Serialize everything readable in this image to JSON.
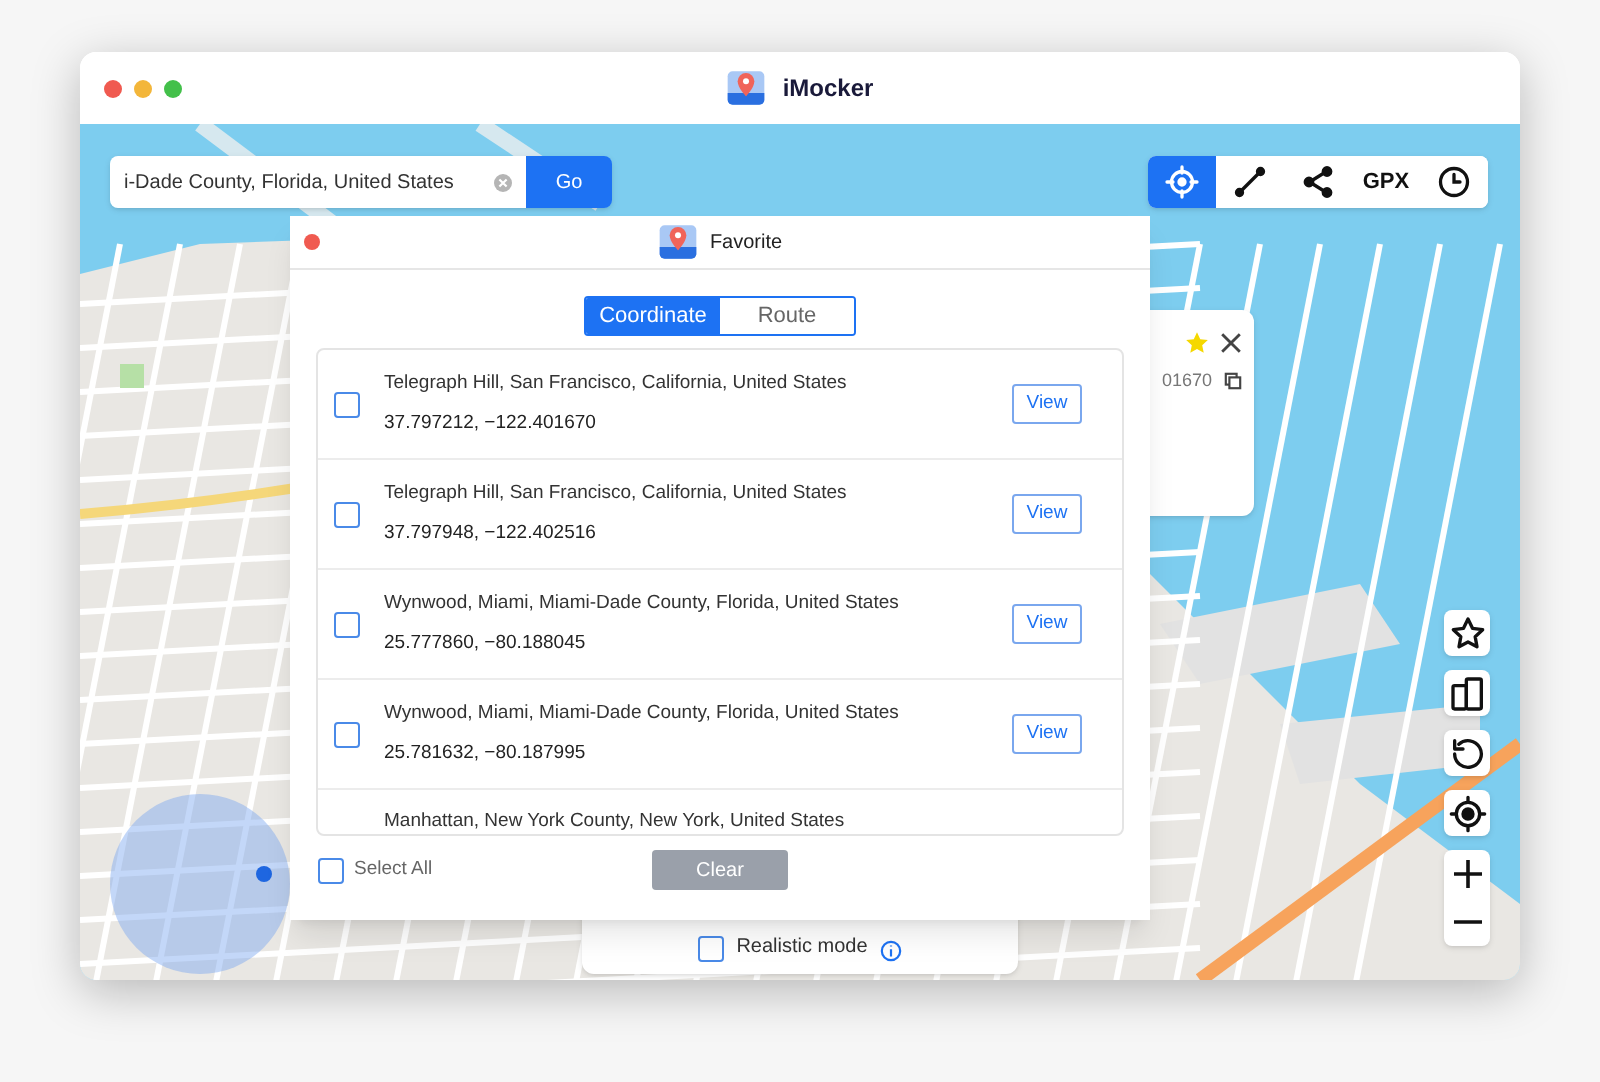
{
  "window": {
    "title": "iMocker"
  },
  "search": {
    "value": "i-Dade County, Florida, United States",
    "go": "Go"
  },
  "toolbar": [
    {
      "kind": "crosshair",
      "selected": true
    },
    {
      "kind": "route",
      "selected": false
    },
    {
      "kind": "share",
      "selected": false
    },
    {
      "kind": "text",
      "label": "GPX",
      "selected": false
    },
    {
      "kind": "history",
      "selected": false
    }
  ],
  "info_card": {
    "coordinate": "01670"
  },
  "realistic_mode": {
    "label": "Realistic mode",
    "checked": false
  },
  "map_controls": [
    {
      "kind": "star"
    },
    {
      "kind": "devices"
    },
    {
      "kind": "reset"
    },
    {
      "kind": "locate"
    },
    {
      "kind": "zoom"
    }
  ],
  "favorite": {
    "title": "Favorite",
    "tabs": [
      {
        "label": "Coordinate",
        "selected": true
      },
      {
        "label": "Route",
        "selected": false
      }
    ],
    "items": [
      {
        "name": "Telegraph Hill, San Francisco, California, United States",
        "coordinates": "37.797212, −122.401670",
        "checked": false,
        "action": "View"
      },
      {
        "name": "Telegraph Hill, San Francisco, California, United States",
        "coordinates": "37.797948, −122.402516",
        "checked": false,
        "action": "View"
      },
      {
        "name": "Wynwood, Miami, Miami-Dade County, Florida, United States",
        "coordinates": "25.777860, −80.188045",
        "checked": false,
        "action": "View"
      },
      {
        "name": "Wynwood, Miami, Miami-Dade County, Florida, United States",
        "coordinates": "25.781632, −80.187995",
        "checked": false,
        "action": "View"
      },
      {
        "name": "Manhattan, New York County, New York, United States"
      }
    ],
    "select_all": {
      "label": "Select All",
      "checked": false
    },
    "clear": "Clear"
  }
}
